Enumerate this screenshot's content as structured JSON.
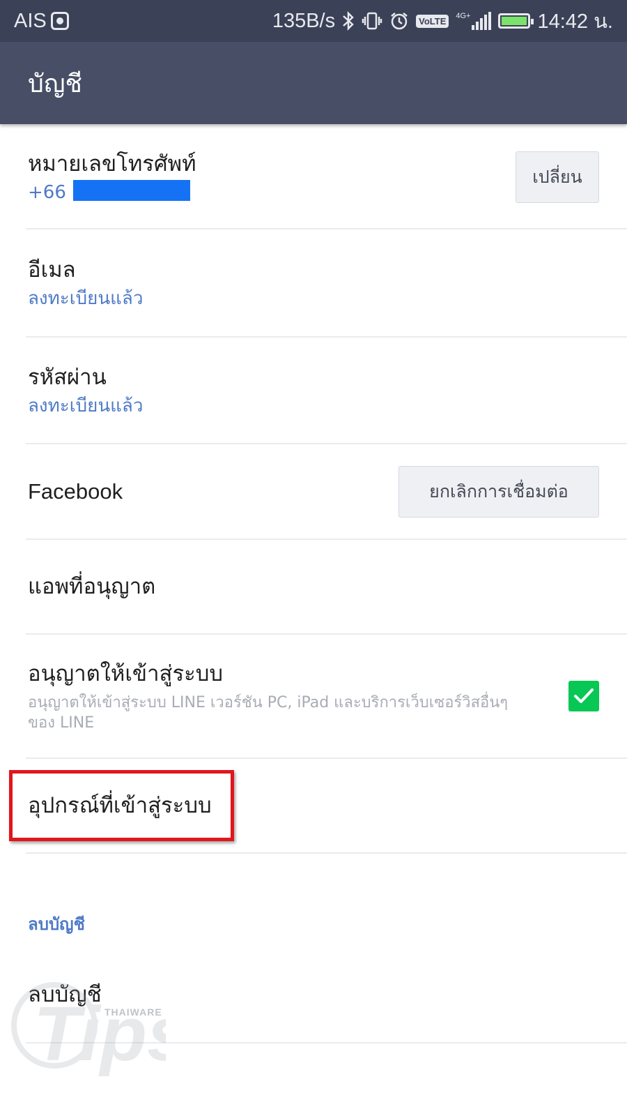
{
  "status_bar": {
    "carrier": "AIS",
    "net_speed": "135B/s",
    "network_badge": "VoLTE",
    "network_type": "4G+",
    "time": "14:42 น.",
    "icons": [
      "carrier-ring-icon",
      "bluetooth-icon",
      "vibrate-icon",
      "alarm-icon",
      "volte-icon",
      "signal-icon",
      "battery-charging-icon"
    ]
  },
  "app_bar": {
    "title": "บัญชี"
  },
  "rows": {
    "phone": {
      "title": "หมายเลขโทรศัพท์",
      "value": "+66",
      "button": "เปลี่ยน"
    },
    "email": {
      "title": "อีเมล",
      "status": "ลงทะเบียนแล้ว"
    },
    "password": {
      "title": "รหัสผ่าน",
      "status": "ลงทะเบียนแล้ว"
    },
    "facebook": {
      "title": "Facebook",
      "button": "ยกเลิกการเชื่อมต่อ"
    },
    "authorized_apps": {
      "title": "แอพที่อนุญาต"
    },
    "allow_login": {
      "title": "อนุญาตให้เข้าสู่ระบบ",
      "description": "อนุญาตให้เข้าสู่ระบบ LINE เวอร์ชัน PC, iPad และบริการเว็บเซอร์วิสอื่นๆ ของ LINE",
      "checked": true
    },
    "logged_in_devices": {
      "title": "อุปกรณ์ที่เข้าสู่ระบบ"
    }
  },
  "delete_section": {
    "header": "ลบบัญชี",
    "item": "ลบบัญชี"
  },
  "watermark": {
    "brand": "THAIWARE",
    "word": "Tips"
  },
  "colors": {
    "status_bar": "#3b4257",
    "app_bar": "#474e66",
    "accent_blue": "#4f7ac7",
    "checkbox_green": "#07c755",
    "highlight_red": "#e0161b",
    "redaction_blue": "#1572f5"
  }
}
